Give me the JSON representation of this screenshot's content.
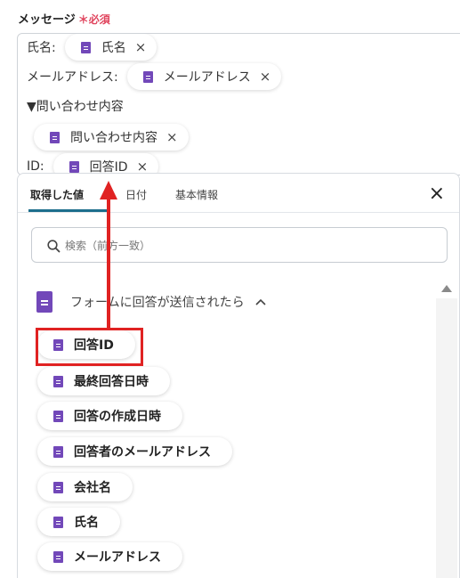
{
  "field": {
    "label": "メッセージ",
    "required": "＊必須"
  },
  "editor": {
    "lines": [
      {
        "label": "氏名:",
        "token": "氏名"
      },
      {
        "label": "メールアドレス:",
        "token": "メールアドレス"
      },
      {
        "label": "▼問い合わせ内容"
      },
      {
        "label": "",
        "token": "問い合わせ内容"
      },
      {
        "label": "ID:",
        "token": "回答ID"
      }
    ],
    "token_close": "×"
  },
  "panel": {
    "tabs": [
      "取得した値",
      "日付",
      "基本情報"
    ],
    "active_tab": "取得した値",
    "close": "×",
    "search_placeholder": "検索（前方一致）",
    "group": {
      "title": "フォームに回答が送信されたら",
      "chevron": "^"
    },
    "items": [
      "回答ID",
      "最終回答日時",
      "回答の作成日時",
      "回答者のメールアドレス",
      "会社名",
      "氏名",
      "メールアドレス"
    ],
    "highlighted_item": "回答ID"
  },
  "colors": {
    "accent": "#1d6e8c",
    "required": "#e0455e",
    "doc_icon": "#7248b9",
    "highlight": "#e02222"
  }
}
